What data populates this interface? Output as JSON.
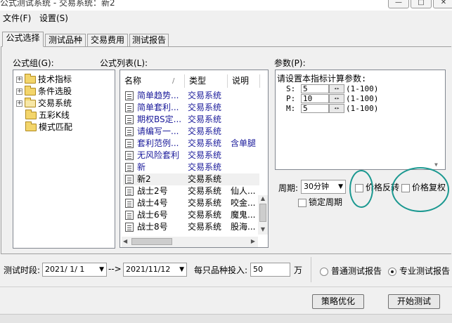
{
  "window": {
    "title": "公式测试系统 - 交易系统：新2",
    "minimize": "—",
    "maximize": "□",
    "close": "✕"
  },
  "menu": [
    "文件(F)",
    "设置(S)"
  ],
  "tabs": [
    "公式选择",
    "测试品种",
    "交易费用",
    "测试报告"
  ],
  "labels": {
    "group": "公式组(G):",
    "list": "公式列表(L):",
    "params": "参数(P):"
  },
  "tree": [
    "技术指标",
    "条件选股",
    "交易系统",
    "五彩K线",
    "模式匹配"
  ],
  "list": {
    "columns": [
      "名称",
      "类型",
      "说明"
    ],
    "rows": [
      {
        "name": "简单趋势...",
        "type": "交易系统",
        "desc": ""
      },
      {
        "name": "简单套利...",
        "type": "交易系统",
        "desc": ""
      },
      {
        "name": "期权BS定...",
        "type": "交易系统",
        "desc": ""
      },
      {
        "name": "请编写一...",
        "type": "交易系统",
        "desc": ""
      },
      {
        "name": "套利范例...",
        "type": "交易系统",
        "desc": "含单腿"
      },
      {
        "name": "无风险套利",
        "type": "交易系统",
        "desc": ""
      },
      {
        "name": "新",
        "type": "交易系统",
        "desc": ""
      },
      {
        "name": "新2",
        "type": "交易系统",
        "desc": ""
      },
      {
        "name": "战士2号",
        "type": "交易系统",
        "desc": "仙人..."
      },
      {
        "name": "战士4号",
        "type": "交易系统",
        "desc": "咬金..."
      },
      {
        "name": "战士6号",
        "type": "交易系统",
        "desc": "魔鬼..."
      },
      {
        "name": "战士8号",
        "type": "交易系统",
        "desc": "股海..."
      }
    ]
  },
  "params": {
    "heading": "请设置本指标计算参数:",
    "rows": [
      {
        "label": "S:",
        "value": "5",
        "range": "(1-100)"
      },
      {
        "label": "P:",
        "value": "10",
        "range": "(1-100)"
      },
      {
        "label": "M:",
        "value": "5",
        "range": "(1-100)"
      }
    ]
  },
  "period": {
    "label": "周期:",
    "value": "30分钟"
  },
  "checks": {
    "reverse": "价格反转",
    "restore": "价格复权",
    "lock": "锁定周期"
  },
  "bottom": {
    "time_label": "测试时段:",
    "date_from": "2021/ 1/ 1",
    "arrow": "-->",
    "date_to": "2021/11/12",
    "invest_label": "每只品种投入:",
    "invest_value": "50",
    "unit": "万",
    "radio_normal": "普通测试报告",
    "radio_pro": "专业测试报告",
    "btn_optimize": "策略优化",
    "btn_start": "开始测试"
  },
  "accent_color": "#1a9890"
}
